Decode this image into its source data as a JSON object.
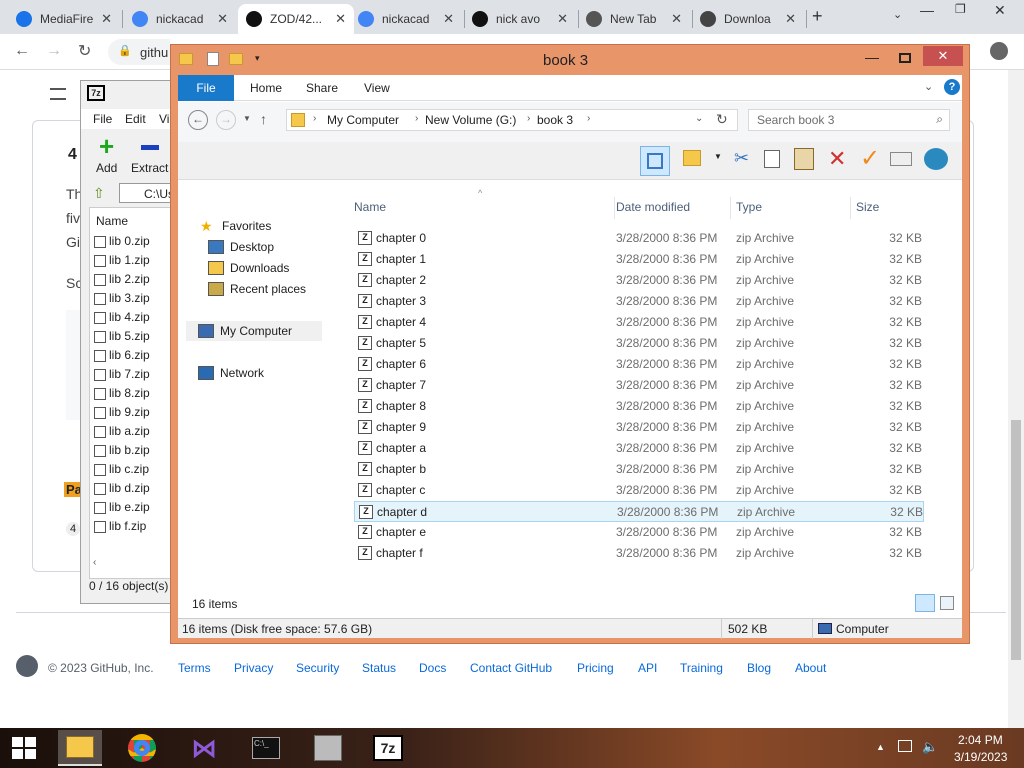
{
  "browser": {
    "tabs": [
      {
        "title": "MediaFire",
        "icon": "mediafire-icon"
      },
      {
        "title": "nickacad",
        "icon": "google-icon"
      },
      {
        "title": "ZOD/42...",
        "icon": "github-icon"
      },
      {
        "title": "nickacad",
        "icon": "google-icon"
      },
      {
        "title": "nick avo",
        "icon": "tiktok-icon"
      },
      {
        "title": "New Tab",
        "icon": "chrome-icon"
      },
      {
        "title": "Downloa",
        "icon": "download-icon"
      }
    ],
    "address_partial": "githu"
  },
  "sevenzip": {
    "menu": [
      "File",
      "Edit",
      "Vi"
    ],
    "add_label": "Add",
    "extract_label": "Extract",
    "path": "C:\\Us",
    "column_name": "Name",
    "files": [
      "lib 0.zip",
      "lib 1.zip",
      "lib 2.zip",
      "lib 3.zip",
      "lib 4.zip",
      "lib 5.zip",
      "lib 6.zip",
      "lib 7.zip",
      "lib 8.zip",
      "lib 9.zip",
      "lib a.zip",
      "lib b.zip",
      "lib c.zip",
      "lib d.zip",
      "lib e.zip",
      "lib f.zip"
    ],
    "status": "0 / 16 object(s)"
  },
  "explorer": {
    "title": "book 3",
    "ribbon_tabs": [
      "File",
      "Home",
      "Share",
      "View"
    ],
    "breadcrumb": [
      "My Computer",
      "New Volume (G:)",
      "book 3"
    ],
    "search_placeholder": "Search book 3",
    "nav": {
      "favorites": "Favorites",
      "desktop": "Desktop",
      "downloads": "Downloads",
      "recent": "Recent places",
      "computer": "My Computer",
      "network": "Network"
    },
    "columns": {
      "name": "Name",
      "date": "Date modified",
      "type": "Type",
      "size": "Size"
    },
    "files": [
      {
        "name": "chapter 0",
        "date": "3/28/2000 8:36 PM",
        "type": "zip Archive",
        "size": "32 KB"
      },
      {
        "name": "chapter 1",
        "date": "3/28/2000 8:36 PM",
        "type": "zip Archive",
        "size": "32 KB"
      },
      {
        "name": "chapter 2",
        "date": "3/28/2000 8:36 PM",
        "type": "zip Archive",
        "size": "32 KB"
      },
      {
        "name": "chapter 3",
        "date": "3/28/2000 8:36 PM",
        "type": "zip Archive",
        "size": "32 KB"
      },
      {
        "name": "chapter 4",
        "date": "3/28/2000 8:36 PM",
        "type": "zip Archive",
        "size": "32 KB"
      },
      {
        "name": "chapter 5",
        "date": "3/28/2000 8:36 PM",
        "type": "zip Archive",
        "size": "32 KB"
      },
      {
        "name": "chapter 6",
        "date": "3/28/2000 8:36 PM",
        "type": "zip Archive",
        "size": "32 KB"
      },
      {
        "name": "chapter 7",
        "date": "3/28/2000 8:36 PM",
        "type": "zip Archive",
        "size": "32 KB"
      },
      {
        "name": "chapter 8",
        "date": "3/28/2000 8:36 PM",
        "type": "zip Archive",
        "size": "32 KB"
      },
      {
        "name": "chapter 9",
        "date": "3/28/2000 8:36 PM",
        "type": "zip Archive",
        "size": "32 KB"
      },
      {
        "name": "chapter a",
        "date": "3/28/2000 8:36 PM",
        "type": "zip Archive",
        "size": "32 KB"
      },
      {
        "name": "chapter b",
        "date": "3/28/2000 8:36 PM",
        "type": "zip Archive",
        "size": "32 KB"
      },
      {
        "name": "chapter c",
        "date": "3/28/2000 8:36 PM",
        "type": "zip Archive",
        "size": "32 KB"
      },
      {
        "name": "chapter d",
        "date": "3/28/2000 8:36 PM",
        "type": "zip Archive",
        "size": "32 KB",
        "selected": true
      },
      {
        "name": "chapter e",
        "date": "3/28/2000 8:36 PM",
        "type": "zip Archive",
        "size": "32 KB"
      },
      {
        "name": "chapter f",
        "date": "3/28/2000 8:36 PM",
        "type": "zip Archive",
        "size": "32 KB"
      }
    ],
    "item_count": "16 items",
    "status_left": "16 items (Disk free space: 57.6 GB)",
    "status_size": "502 KB",
    "status_location": "Computer"
  },
  "github": {
    "fragments": [
      "4",
      "Th",
      "fiv",
      "Gi",
      "Sc",
      "Pa",
      "4"
    ],
    "copyright": "© 2023 GitHub, Inc.",
    "footer_links": [
      "Terms",
      "Privacy",
      "Security",
      "Status",
      "Docs",
      "Contact GitHub",
      "Pricing",
      "API",
      "Training",
      "Blog",
      "About"
    ]
  },
  "taskbar": {
    "time": "2:04 PM",
    "date": "3/19/2023"
  },
  "colors": {
    "explorer_frame": "#e8956a",
    "accent": "#1979ca",
    "close_button": "#c75050"
  }
}
